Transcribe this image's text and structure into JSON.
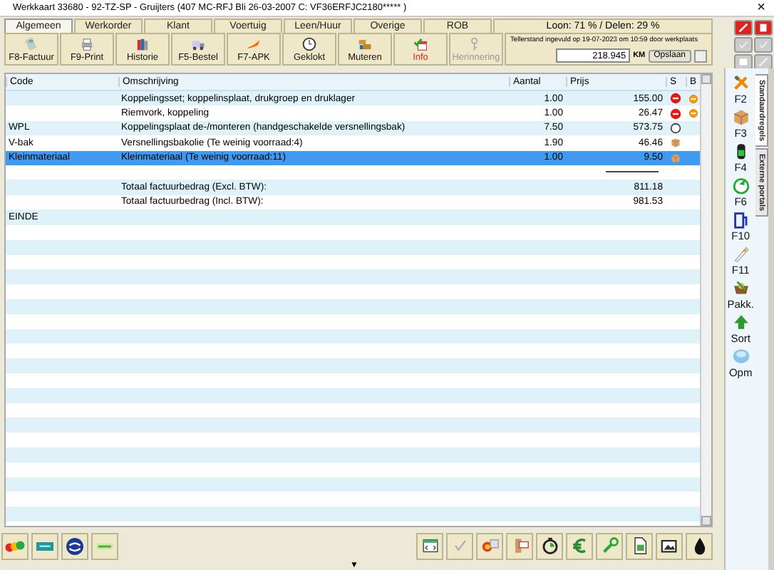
{
  "window": {
    "title": "Werkkaart 33680 - 92-TZ-SP - Gruijters (407 MC-RFJ Bli 26-03-2007 C: VF36ERFJC2180***** )",
    "close": "×"
  },
  "tabs": [
    {
      "label": "Algemeen",
      "selected": true
    },
    {
      "label": "Werkorder",
      "selected": false
    },
    {
      "label": "Klant",
      "selected": false
    },
    {
      "label": "Voertuig",
      "selected": false
    },
    {
      "label": "Leen/Huur",
      "selected": false
    },
    {
      "label": "Overige",
      "selected": false
    },
    {
      "label": "ROB",
      "selected": false
    }
  ],
  "wage_summary": "Loon: 71 % / Delen: 29 %",
  "toolbar": [
    {
      "label": "F8-Factuur",
      "highlighted": false,
      "disabled": false
    },
    {
      "label": "F9-Print",
      "highlighted": false,
      "disabled": false
    },
    {
      "label": "Historie",
      "highlighted": false,
      "disabled": false
    },
    {
      "label": "F5-Bestel",
      "highlighted": false,
      "disabled": false
    },
    {
      "label": "F7-APK",
      "highlighted": false,
      "disabled": false
    },
    {
      "label": "Geklokt",
      "highlighted": false,
      "disabled": false
    },
    {
      "label": "Muteren",
      "highlighted": false,
      "disabled": false
    },
    {
      "label": "Info",
      "highlighted": true,
      "disabled": false
    },
    {
      "label": "Herinnering",
      "highlighted": false,
      "disabled": true
    }
  ],
  "odometer": {
    "note": "Tellerstand ingevuld op 19-07-2023 om 10:59 door werkplaats",
    "value": "218.945",
    "unit": "KM",
    "save": "Opslaan"
  },
  "table": {
    "columns": [
      "Code",
      "Omschrijving",
      "Aantal",
      "Prijs",
      "S",
      "B"
    ],
    "rows": [
      {
        "kind": "item",
        "description": "Koppelingsset; koppelinsplaat, drukgroep en druklager",
        "quantity": "1.00",
        "price": "155.00",
        "s_mark": {
          "kind": "error"
        },
        "b_mark": {
          "kind": "warning"
        },
        "selected": false
      },
      {
        "kind": "item",
        "description": "Riemvork, koppeling",
        "quantity": "1.00",
        "price": "26.47",
        "s_mark": {
          "kind": "error"
        },
        "b_mark": {
          "kind": "warning"
        },
        "selected": false
      },
      {
        "kind": "item",
        "code": "WPL",
        "description": "Koppelingsplaat de-/monteren (handgeschakelde versnellingsbak)",
        "quantity": "7.50",
        "price": "573.75",
        "s_mark": {
          "kind": "labour"
        },
        "selected": false
      },
      {
        "kind": "item",
        "code": "V-bak",
        "description": "Versnellingsbakolie (Te weinig voorraad:4)",
        "quantity": "1.90",
        "price": "46.46",
        "s_mark": {
          "kind": "stock"
        },
        "selected": false
      },
      {
        "kind": "item",
        "code": "Kleinmateriaal",
        "description": "Kleinmateriaal (Te weinig voorraad:11)",
        "quantity": "1.00",
        "price": "9.50",
        "s_mark": {
          "kind": "stock"
        },
        "selected": true
      },
      {
        "kind": "blank"
      },
      {
        "kind": "total",
        "description": "Totaal factuurbedrag (Excl. BTW):",
        "price": "811.18"
      },
      {
        "kind": "total",
        "description": "Totaal factuurbedrag (Incl. BTW):",
        "price": "981.53"
      },
      {
        "kind": "end",
        "code": "EINDE"
      }
    ]
  },
  "sidebar": {
    "items": [
      {
        "label": "F2"
      },
      {
        "label": "F3"
      },
      {
        "label": "F4"
      },
      {
        "label": "F6"
      },
      {
        "label": "F10"
      },
      {
        "label": "F11"
      },
      {
        "label": "Pakk."
      },
      {
        "label": "Sort"
      },
      {
        "label": "Opm"
      }
    ],
    "tabs": [
      {
        "label": "Standaardregels",
        "selected": true
      },
      {
        "label": "Externe portals",
        "selected": false
      }
    ]
  },
  "bottom_bar": {
    "expand": "▼"
  }
}
